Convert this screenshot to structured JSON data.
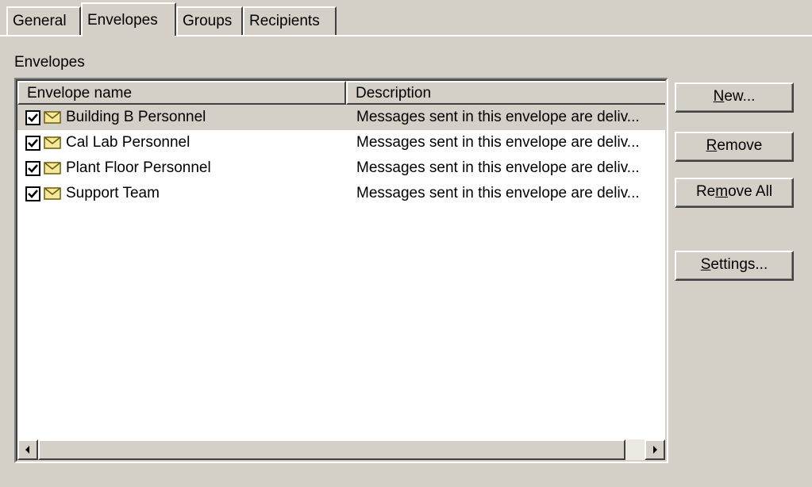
{
  "tabs": [
    {
      "label": "General"
    },
    {
      "label": "Envelopes",
      "active": true
    },
    {
      "label": "Groups"
    },
    {
      "label": "Recipients"
    }
  ],
  "envelopes_group": {
    "label": "Envelopes"
  },
  "list": {
    "columns": [
      {
        "label": "Envelope name"
      },
      {
        "label": "Description"
      }
    ],
    "rows": [
      {
        "name": "Building B Personnel",
        "description": "Messages sent in this envelope are deliv...",
        "checked": true,
        "selected": true
      },
      {
        "name": "Cal Lab Personnel",
        "description": "Messages sent in this envelope are deliv...",
        "checked": true,
        "selected": false
      },
      {
        "name": "Plant Floor Personnel",
        "description": "Messages sent in this envelope are deliv...",
        "checked": true,
        "selected": false
      },
      {
        "name": "Support Team",
        "description": "Messages sent in this envelope are deliv...",
        "checked": true,
        "selected": false
      }
    ]
  },
  "buttons": {
    "new": {
      "pre": "",
      "accel": "N",
      "post": "ew..."
    },
    "remove": {
      "pre": "",
      "accel": "R",
      "post": "emove"
    },
    "remove_all": {
      "pre": "Re",
      "accel": "m",
      "post": "ove All"
    },
    "settings": {
      "pre": "",
      "accel": "S",
      "post": "ettings..."
    }
  },
  "icons": {
    "checkbox": "checkbox-checked-icon",
    "envelope": "envelope-icon",
    "scroll_left": "arrow-left-icon",
    "scroll_right": "arrow-right-icon"
  }
}
